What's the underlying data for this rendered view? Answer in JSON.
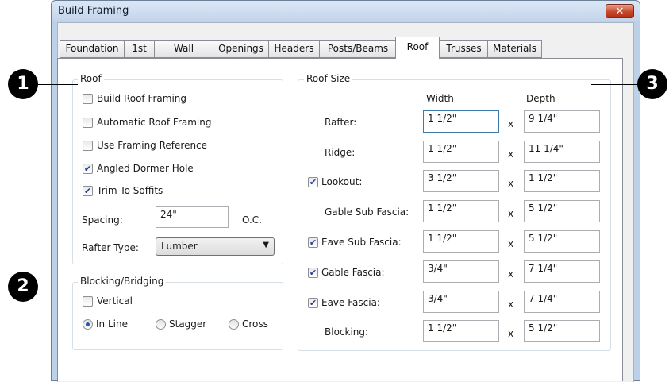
{
  "window": {
    "title": "Build Framing",
    "close_label": "✕"
  },
  "tabs": [
    {
      "label": "Foundation"
    },
    {
      "label": "1st"
    },
    {
      "label": "Wall"
    },
    {
      "label": "Openings"
    },
    {
      "label": "Headers"
    },
    {
      "label": "Posts/Beams"
    },
    {
      "label": "Roof"
    },
    {
      "label": "Trusses"
    },
    {
      "label": "Materials"
    }
  ],
  "active_tab": "Roof",
  "roof": {
    "legend": "Roof",
    "checkboxes": [
      {
        "label": "Build Roof Framing",
        "checked": false
      },
      {
        "label": "Automatic Roof Framing",
        "checked": false
      },
      {
        "label": "Use Framing Reference",
        "checked": false
      },
      {
        "label": "Angled Dormer Hole",
        "checked": true
      },
      {
        "label": "Trim To Soffits",
        "checked": true
      }
    ],
    "spacing_label": "Spacing:",
    "spacing_value": "24\"",
    "spacing_unit": "O.C.",
    "rafter_type_label": "Rafter Type:",
    "rafter_type_value": "Lumber"
  },
  "blocking": {
    "legend": "Blocking/Bridging",
    "vertical": {
      "label": "Vertical",
      "checked": false
    },
    "radios": [
      {
        "label": "In Line",
        "selected": true
      },
      {
        "label": "Stagger",
        "selected": false
      },
      {
        "label": "Cross",
        "selected": false
      }
    ]
  },
  "roof_size": {
    "legend": "Roof Size",
    "col_width": "Width",
    "col_depth": "Depth",
    "separator": "x",
    "rows": [
      {
        "label": "Rafter:",
        "has_checkbox": false,
        "checked": false,
        "width": "1 1/2\"",
        "depth": "9 1/4\""
      },
      {
        "label": "Ridge:",
        "has_checkbox": false,
        "checked": false,
        "width": "1 1/2\"",
        "depth": "11 1/4\""
      },
      {
        "label": "Lookout:",
        "has_checkbox": true,
        "checked": true,
        "width": "3 1/2\"",
        "depth": "1 1/2\""
      },
      {
        "label": "Gable Sub Fascia:",
        "has_checkbox": false,
        "checked": false,
        "width": "1 1/2\"",
        "depth": "5 1/2\""
      },
      {
        "label": "Eave Sub Fascia:",
        "has_checkbox": true,
        "checked": true,
        "width": "1 1/2\"",
        "depth": "5 1/2\""
      },
      {
        "label": "Gable Fascia:",
        "has_checkbox": true,
        "checked": true,
        "width": "3/4\"",
        "depth": "7 1/4\""
      },
      {
        "label": "Eave Fascia:",
        "has_checkbox": true,
        "checked": true,
        "width": "3/4\"",
        "depth": "7 1/4\""
      },
      {
        "label": "Blocking:",
        "has_checkbox": false,
        "checked": false,
        "width": "1 1/2\"",
        "depth": "5 1/2\""
      }
    ]
  },
  "callouts": [
    "1",
    "2",
    "3"
  ],
  "colors": {
    "check_mark": "#1e3e9a",
    "callout": "#000000",
    "window_frame": "#bcd0e8"
  },
  "check_glyph": "✔"
}
